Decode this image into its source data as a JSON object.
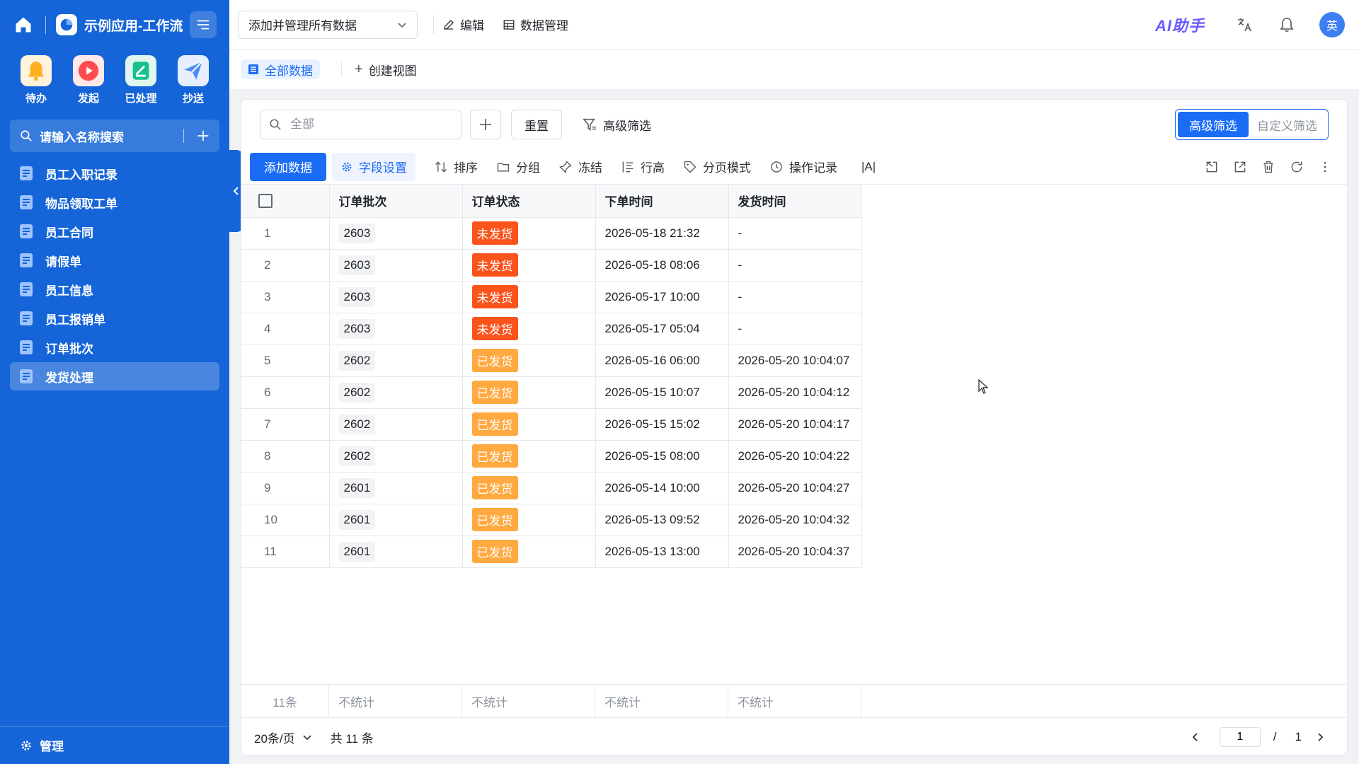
{
  "sidebar": {
    "app_title": "示例应用-工作流",
    "quick": [
      {
        "label": "待办",
        "icon": "bell-icon",
        "color": "#ffb020"
      },
      {
        "label": "发起",
        "icon": "play-icon",
        "color": "#ff4d4f"
      },
      {
        "label": "已处理",
        "icon": "check-doc-icon",
        "color": "#18c08f"
      },
      {
        "label": "抄送",
        "icon": "send-icon",
        "color": "#4a8cf7"
      }
    ],
    "search_placeholder": "请输入名称搜索",
    "items": [
      {
        "label": "员工入职记录"
      },
      {
        "label": "物品领取工单"
      },
      {
        "label": "员工合同"
      },
      {
        "label": "请假单"
      },
      {
        "label": "员工信息"
      },
      {
        "label": "员工报销单"
      },
      {
        "label": "订单批次"
      },
      {
        "label": "发货处理"
      }
    ],
    "active_index": 7,
    "bottom_label": "管理"
  },
  "header": {
    "view_select": "添加并管理所有数据",
    "edit_label": "编辑",
    "data_manage_label": "数据管理",
    "ai_label": "AI助手",
    "avatar_text": "英"
  },
  "viewbar": {
    "active_tab": "全部数据",
    "create_view": "创建视图"
  },
  "filter": {
    "search_placeholder": "全部",
    "reset_label": "重置",
    "advanced_label": "高级筛选",
    "seg_on": "高级筛选",
    "seg_off": "自定义筛选"
  },
  "toolbar": {
    "add_label": "添加数据",
    "field_settings": "字段设置",
    "sort": "排序",
    "group": "分组",
    "freeze": "冻结",
    "row_height": "行高",
    "page_mode": "分页模式",
    "history": "操作记录",
    "font_icon_text": "|A|"
  },
  "table": {
    "columns": [
      "订单批次",
      "订单状态",
      "下单时间",
      "发货时间"
    ],
    "status_colors": {
      "未发货": "#fa541c",
      "已发货": "#ffa940"
    },
    "rows": [
      {
        "idx": "1",
        "batch": "2603",
        "status": "未发货",
        "order_time": "2026-05-18 21:32",
        "ship_time": "-"
      },
      {
        "idx": "2",
        "batch": "2603",
        "status": "未发货",
        "order_time": "2026-05-18 08:06",
        "ship_time": "-"
      },
      {
        "idx": "3",
        "batch": "2603",
        "status": "未发货",
        "order_time": "2026-05-17 10:00",
        "ship_time": "-"
      },
      {
        "idx": "4",
        "batch": "2603",
        "status": "未发货",
        "order_time": "2026-05-17 05:04",
        "ship_time": "-"
      },
      {
        "idx": "5",
        "batch": "2602",
        "status": "已发货",
        "order_time": "2026-05-16 06:00",
        "ship_time": "2026-05-20 10:04:07"
      },
      {
        "idx": "6",
        "batch": "2602",
        "status": "已发货",
        "order_time": "2026-05-15 10:07",
        "ship_time": "2026-05-20 10:04:12"
      },
      {
        "idx": "7",
        "batch": "2602",
        "status": "已发货",
        "order_time": "2026-05-15 15:02",
        "ship_time": "2026-05-20 10:04:17"
      },
      {
        "idx": "8",
        "batch": "2602",
        "status": "已发货",
        "order_time": "2026-05-15 08:00",
        "ship_time": "2026-05-20 10:04:22"
      },
      {
        "idx": "9",
        "batch": "2601",
        "status": "已发货",
        "order_time": "2026-05-14 10:00",
        "ship_time": "2026-05-20 10:04:27"
      },
      {
        "idx": "10",
        "batch": "2601",
        "status": "已发货",
        "order_time": "2026-05-13 09:52",
        "ship_time": "2026-05-20 10:04:32"
      },
      {
        "idx": "11",
        "batch": "2601",
        "status": "已发货",
        "order_time": "2026-05-13 13:00",
        "ship_time": "2026-05-20 10:04:37"
      }
    ]
  },
  "summary": {
    "count": "11条",
    "cells": [
      "不统计",
      "不统计",
      "不统计",
      "不统计"
    ]
  },
  "pager": {
    "page_size": "20条/页",
    "total": "共 11 条",
    "current": "1",
    "slash": "/",
    "pages": "1"
  }
}
